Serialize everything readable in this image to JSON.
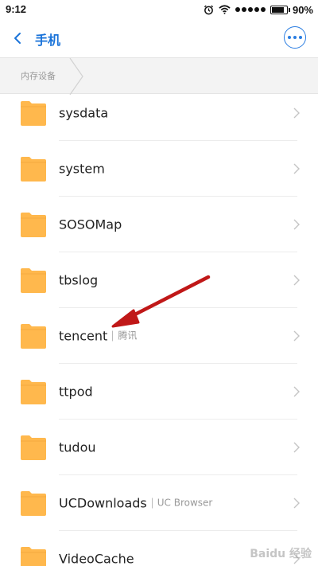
{
  "status_bar": {
    "time": "9:12",
    "battery_text": "90%",
    "battery_level": 0.9,
    "icons": [
      "alarm-icon",
      "wifi-icon",
      "signal-icon",
      "battery-icon"
    ]
  },
  "header": {
    "title": "手机",
    "accent_color": "#1a73d9",
    "back_icon": "chevron-left-icon",
    "more_icon": "more-dots-icon"
  },
  "breadcrumb": {
    "items": [
      "内存设备"
    ]
  },
  "folders": [
    {
      "name": "sysdata",
      "alias": ""
    },
    {
      "name": "system",
      "alias": ""
    },
    {
      "name": "SOSOMap",
      "alias": ""
    },
    {
      "name": "tbslog",
      "alias": ""
    },
    {
      "name": "tencent",
      "alias": "腾讯"
    },
    {
      "name": "ttpod",
      "alias": ""
    },
    {
      "name": "tudou",
      "alias": ""
    },
    {
      "name": "UCDownloads",
      "alias": "UC Browser"
    },
    {
      "name": "VideoCache",
      "alias": ""
    }
  ],
  "folder_color": "#ffb84d",
  "annotation": {
    "type": "arrow",
    "color": "#c01818",
    "points_to": "tencent"
  },
  "watermark": "Baidu 经验"
}
